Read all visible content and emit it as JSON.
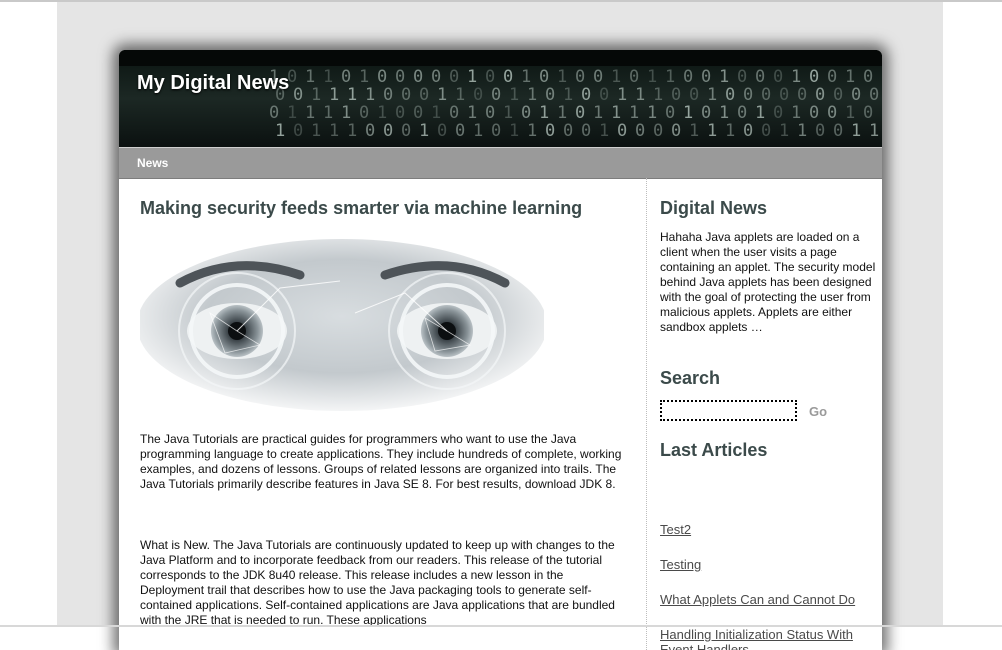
{
  "header": {
    "site_title": "My Digital News"
  },
  "nav": {
    "items": [
      {
        "label": "News"
      }
    ]
  },
  "article": {
    "title": "Making security feeds smarter via machine learning",
    "paragraphs": [
      "The Java Tutorials are practical guides for programmers who want to use the Java programming language to create applications. They include hundreds of complete, working examples, and dozens of lessons. Groups of related lessons are organized into trails. The Java Tutorials primarily describe features in Java SE 8. For best results, download JDK 8.",
      "What is New. The Java Tutorials are continuously updated to keep up with changes to the Java Platform and to incorporate feedback from our readers. This release of the tutorial corresponds to the JDK 8u40 release. This release includes a new lesson in the Deployment trail that describes how to use the Java packaging tools to generate self-contained applications. Self-contained applications are Java applications that are bundled with the JRE that is needed to run. These applications"
    ]
  },
  "sidebar": {
    "about_heading": "Digital News",
    "about_text": "Hahaha Java applets are loaded on a client when the user visits a page containing an applet. The security model behind Java applets has been designed with the goal of protecting the user from malicious applets. Applets are either sandbox applets …",
    "search_heading": "Search",
    "search_value": "",
    "go_label": "Go",
    "last_heading": "Last Articles",
    "last_articles": [
      {
        "label": "Test2"
      },
      {
        "label": "Testing"
      },
      {
        "label": "What Applets Can and Cannot Do"
      },
      {
        "label": "Handling Initialization Status With Event Handlers"
      }
    ]
  },
  "colors": {
    "heading": "#3b4a4a",
    "nav_bar": "#9a9a9a",
    "header_bg": "#0d1512",
    "link": "#4a4a4a"
  },
  "icons": {
    "header_art": "binary-code-banner-image",
    "hero": "eyes-scan-image"
  }
}
